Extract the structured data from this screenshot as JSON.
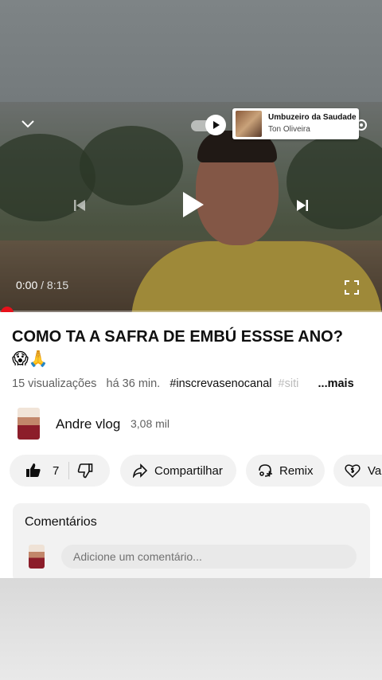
{
  "video": {
    "current_time": "0:00",
    "duration": "8:15",
    "time_separator": " / "
  },
  "music": {
    "title": "Umbuzeiro da Saudade",
    "artist": "Ton Oliveira"
  },
  "info": {
    "title": "COMO TA A SAFRA DE EMBÚ ESSSE ANO?",
    "title_emojis": "😱🙏",
    "views": "15 visualizações",
    "age": "há 36 min.",
    "hashtag1": "#inscrevasenocanal",
    "hashtag2": "#siti",
    "more": "...mais"
  },
  "channel": {
    "name": "Andre vlog",
    "subscribers": "3,08 mil"
  },
  "actions": {
    "like_count": "7",
    "share_label": "Compartilhar",
    "remix_label": "Remix",
    "thanks_label": "Va"
  },
  "comments": {
    "title": "Comentários",
    "placeholder": "Adicione um comentário..."
  },
  "colors": {
    "accent_red": "#e8111b",
    "text_primary": "#0f0f0f",
    "text_secondary": "#606060",
    "pill_bg": "#f2f2f2"
  },
  "icons": [
    "chevron-down-icon",
    "autoplay-toggle",
    "previous-icon",
    "play-icon",
    "next-icon",
    "fullscreen-icon",
    "settings-gear-icon",
    "like-icon",
    "dislike-icon",
    "share-icon",
    "remix-icon",
    "thanks-icon"
  ]
}
